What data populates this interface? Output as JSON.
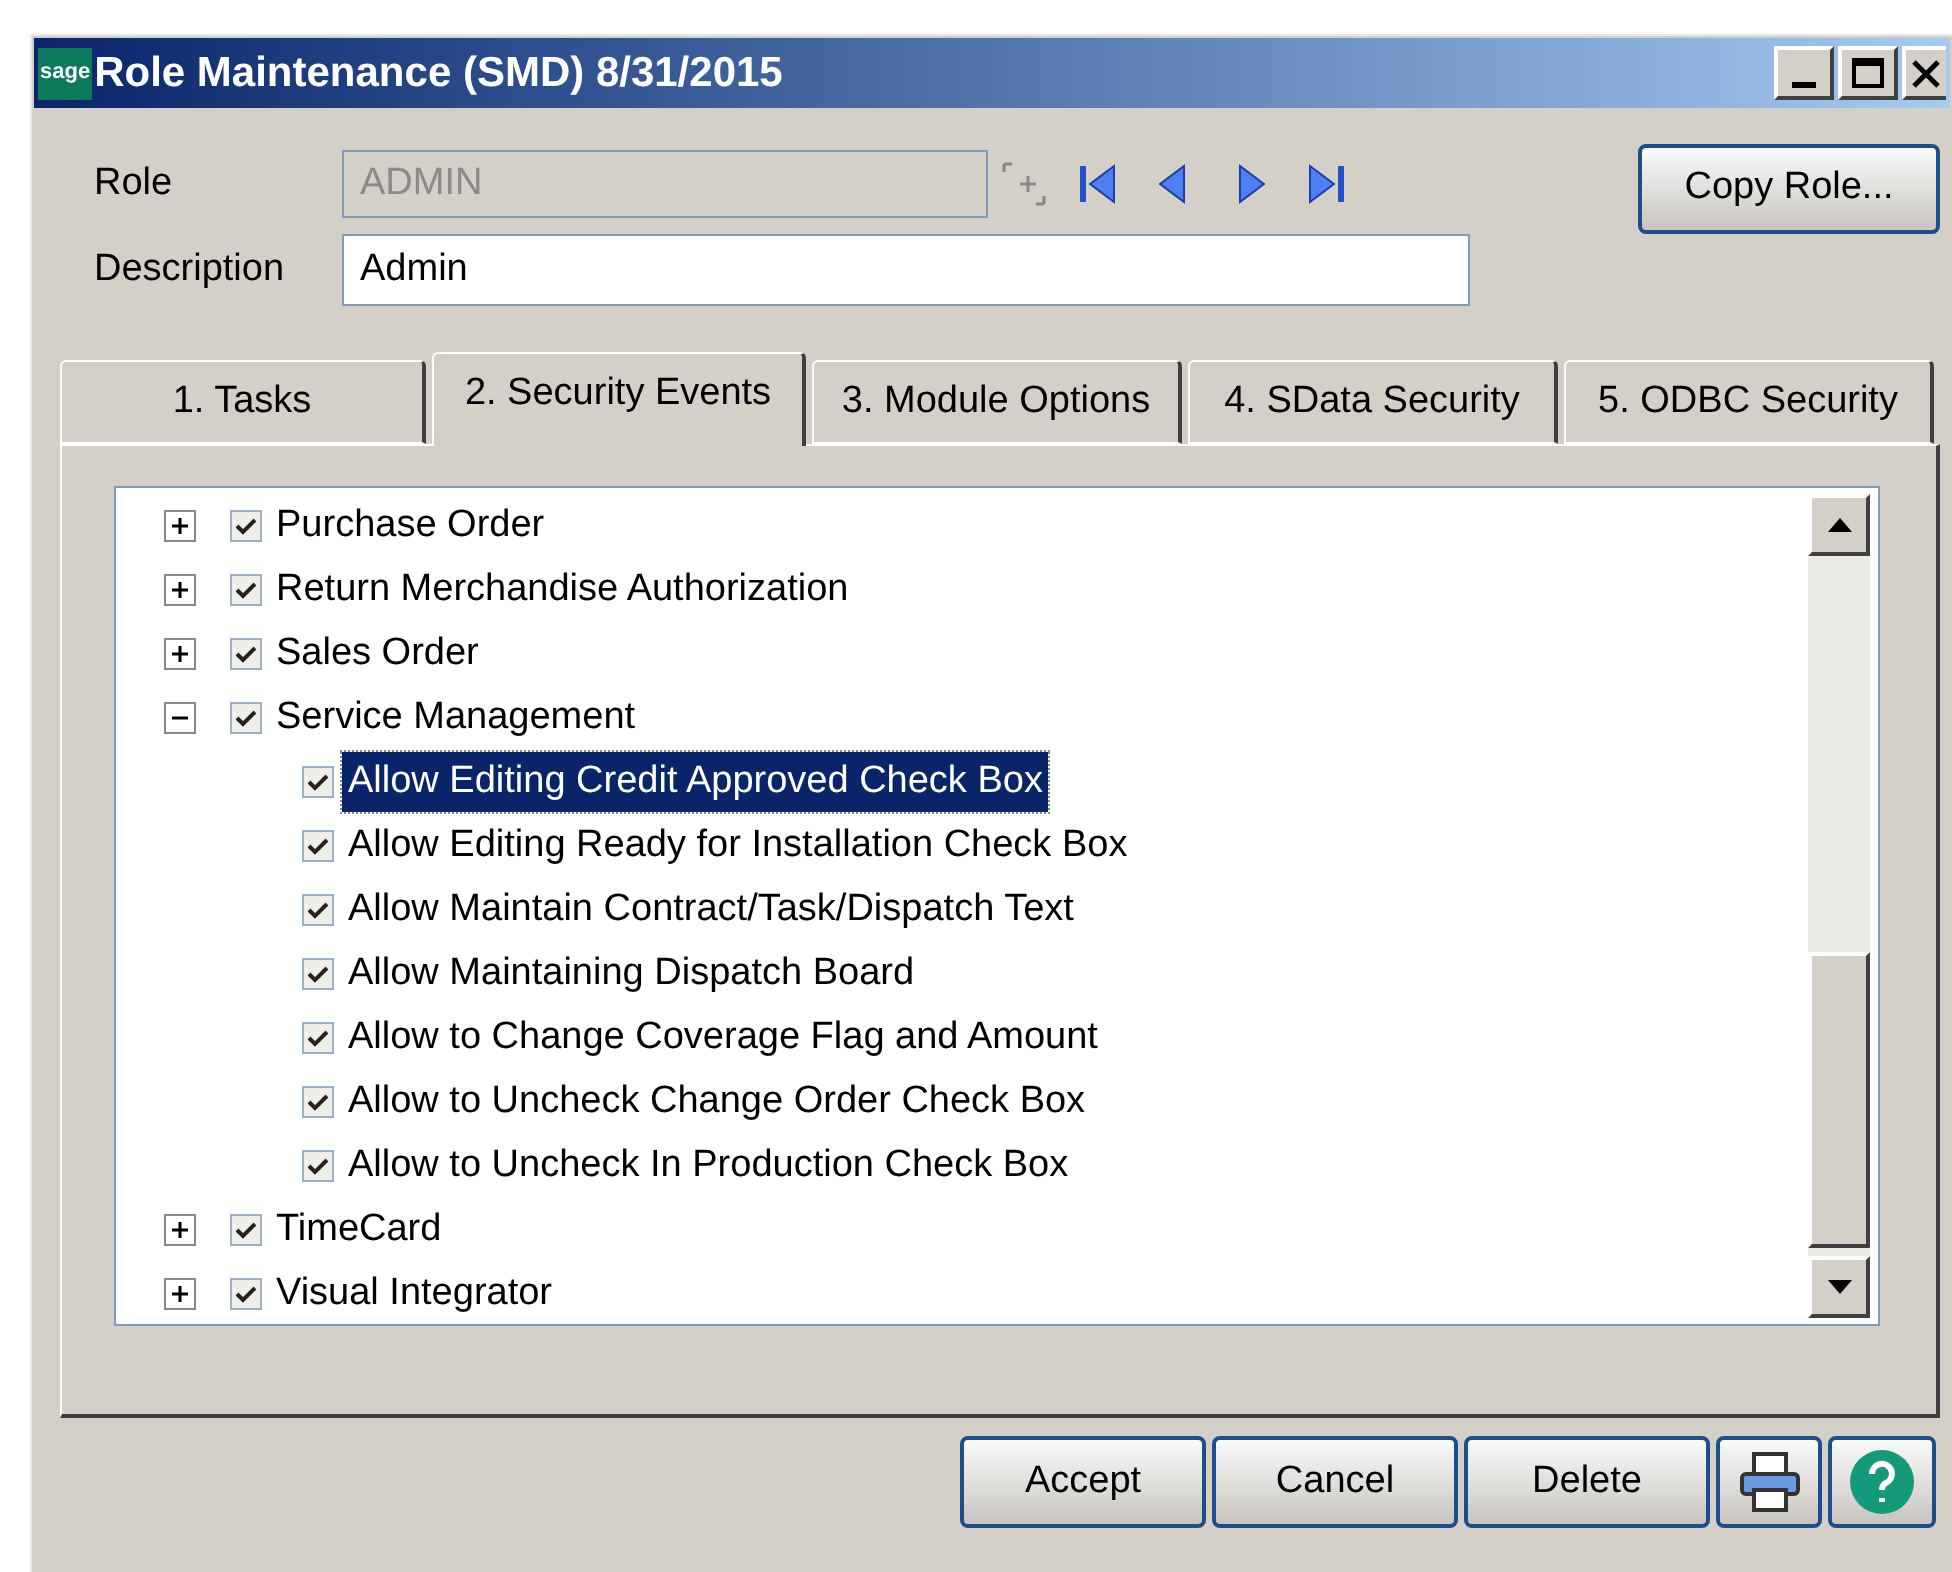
{
  "window": {
    "title": "Role Maintenance (SMD) 8/31/2015",
    "app_logo": "sage"
  },
  "form": {
    "role_label": "Role",
    "role_value": "ADMIN",
    "role_disabled": true,
    "description_label": "Description",
    "description_value": "Admin",
    "copy_button": "Copy Role..."
  },
  "tabs": [
    {
      "label": "1. Tasks",
      "selected": false
    },
    {
      "label": "2. Security Events",
      "selected": true
    },
    {
      "label": "3. Module Options",
      "selected": false
    },
    {
      "label": "4. SData Security",
      "selected": false
    },
    {
      "label": "5. ODBC Security",
      "selected": false
    }
  ],
  "tree": [
    {
      "label": "Purchase Order",
      "checked": true,
      "expanded": false,
      "selected": false
    },
    {
      "label": "Return Merchandise Authorization",
      "checked": true,
      "expanded": false,
      "selected": false
    },
    {
      "label": "Sales Order",
      "checked": true,
      "expanded": false,
      "selected": false
    },
    {
      "label": "Service Management",
      "checked": true,
      "expanded": true,
      "selected": false,
      "children": [
        {
          "label": "Allow Editing Credit Approved Check Box",
          "checked": true,
          "selected": true
        },
        {
          "label": "Allow Editing Ready for Installation Check Box",
          "checked": true,
          "selected": false
        },
        {
          "label": "Allow Maintain Contract/Task/Dispatch Text",
          "checked": true,
          "selected": false
        },
        {
          "label": "Allow Maintaining Dispatch Board",
          "checked": true,
          "selected": false
        },
        {
          "label": "Allow to Change Coverage Flag and Amount",
          "checked": true,
          "selected": false
        },
        {
          "label": "Allow to Uncheck Change Order Check Box",
          "checked": true,
          "selected": false
        },
        {
          "label": "Allow to Uncheck In Production Check Box",
          "checked": true,
          "selected": false
        }
      ]
    },
    {
      "label": "TimeCard",
      "checked": true,
      "expanded": false,
      "selected": false
    },
    {
      "label": "Visual Integrator",
      "checked": true,
      "expanded": false,
      "selected": false
    }
  ],
  "buttons": [
    "Accept",
    "Cancel",
    "Delete"
  ]
}
